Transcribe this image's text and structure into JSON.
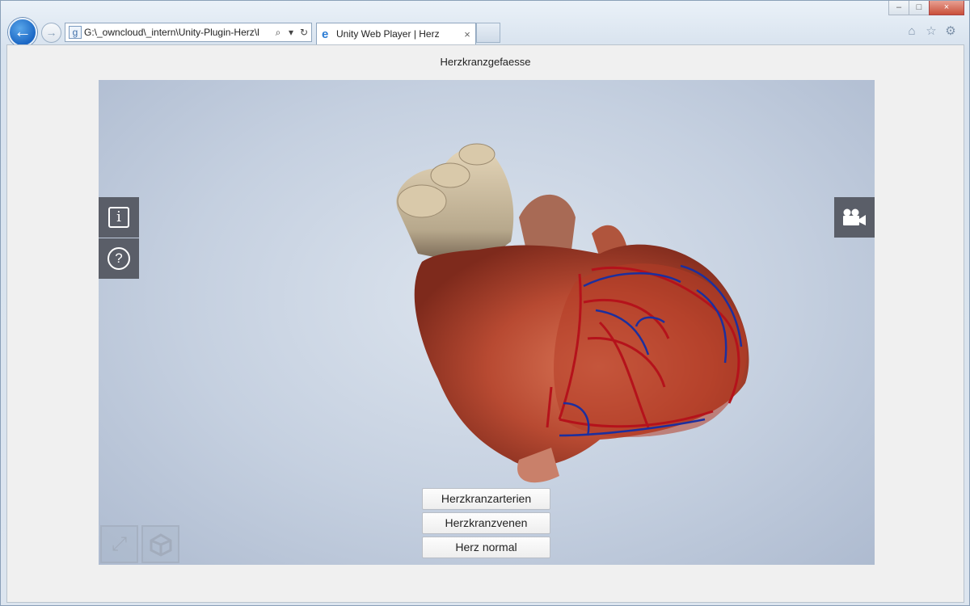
{
  "browser": {
    "address": "G:\\_owncloud\\_intern\\Unity-Plugin-Herz\\l",
    "tab_title": "Unity Web Player | Herz",
    "tab_close": "×",
    "back_glyph": "←",
    "forward_glyph": "→",
    "address_icon": "g",
    "search_glyph": "⌕",
    "dropdown_glyph": "▾",
    "refresh_glyph": "↻",
    "home_glyph": "⌂",
    "favorites_glyph": "☆",
    "tools_glyph": "⚙",
    "minimize_glyph": "–",
    "maximize_glyph": "□",
    "close_glyph": "×"
  },
  "page": {
    "title": "Herzkranzgefaesse"
  },
  "player": {
    "info_glyph": "i",
    "help_glyph": "?",
    "fullscreen_glyph": "⤢",
    "buttons": [
      {
        "label": "Herzkranzarterien"
      },
      {
        "label": "Herzkranzvenen"
      },
      {
        "label": "Herz normal"
      }
    ]
  },
  "icons": [
    "back-arrow-icon",
    "forward-arrow-icon",
    "search-icon",
    "refresh-icon",
    "ie-icon",
    "home-icon",
    "star-icon",
    "gear-icon",
    "info-icon",
    "help-icon",
    "camera-icon",
    "fullscreen-icon",
    "unity-logo-icon"
  ],
  "colors": {
    "panel_button": "#5a5e68",
    "player_bg": "#c5d0e0",
    "artery": "#b5121b",
    "vein": "#1c2f9e"
  }
}
